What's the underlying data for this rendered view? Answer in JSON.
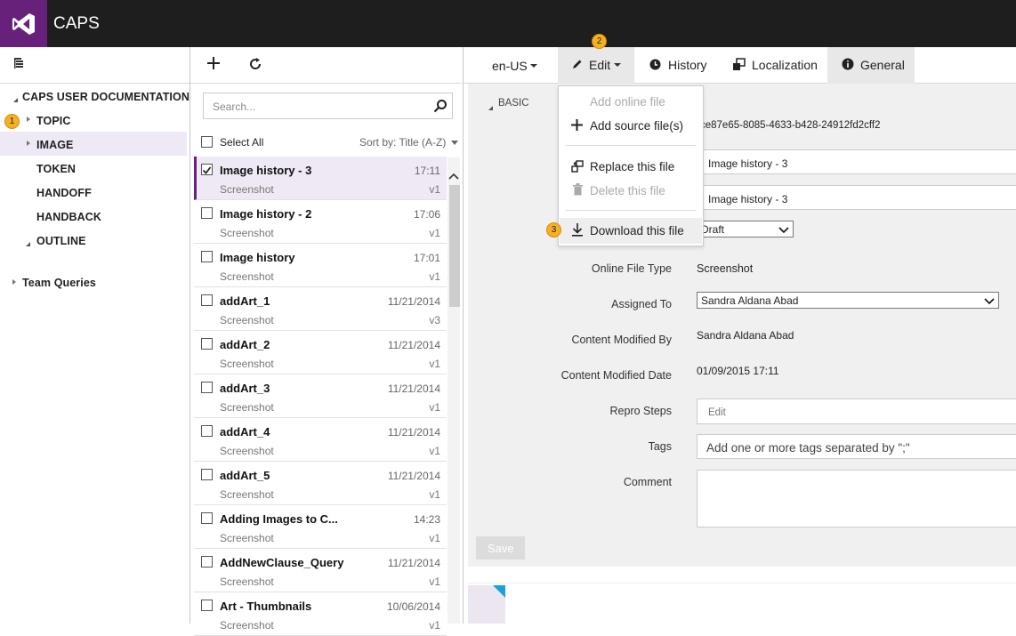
{
  "app": {
    "title": "CAPS"
  },
  "left_tree": {
    "root": "CAPS USER DOCUMENTATION",
    "items": [
      "TOPIC",
      "IMAGE",
      "TOKEN",
      "HANDOFF",
      "HANDBACK",
      "OUTLINE"
    ],
    "team_queries": "Team Queries"
  },
  "badges": {
    "one": "1",
    "two": "2",
    "three": "3"
  },
  "list": {
    "search_placeholder": "Search...",
    "select_all": "Select All",
    "sort_label": "Sort by: Title (A-Z)",
    "rows": [
      {
        "title": "Image history - 3",
        "time": "17:11",
        "sub": "Screenshot",
        "ver": "v1",
        "checked": true
      },
      {
        "title": "Image history - 2",
        "time": "17:06",
        "sub": "Screenshot",
        "ver": "v1"
      },
      {
        "title": "Image history",
        "time": "17:01",
        "sub": "Screenshot",
        "ver": "v1"
      },
      {
        "title": "addArt_1",
        "time": "11/21/2014",
        "sub": "Screenshot",
        "ver": "v3"
      },
      {
        "title": "addArt_2",
        "time": "11/21/2014",
        "sub": "Screenshot",
        "ver": "v1"
      },
      {
        "title": "addArt_3",
        "time": "11/21/2014",
        "sub": "Screenshot",
        "ver": "v1"
      },
      {
        "title": "addArt_4",
        "time": "11/21/2014",
        "sub": "Screenshot",
        "ver": "v1"
      },
      {
        "title": "addArt_5",
        "time": "11/21/2014",
        "sub": "Screenshot",
        "ver": "v1"
      },
      {
        "title": "Adding Images to C...",
        "time": "14:23",
        "sub": "Screenshot",
        "ver": "v1"
      },
      {
        "title": "AddNewClause_Query",
        "time": "11/21/2014",
        "sub": "Screenshot",
        "ver": "v1"
      },
      {
        "title": "Art - Thumbnails",
        "time": "10/06/2014",
        "sub": "Screenshot",
        "ver": "v1"
      }
    ]
  },
  "tabs": {
    "lang": "en-US",
    "edit": "Edit",
    "history": "History",
    "localization": "Localization",
    "general": "General"
  },
  "edit_menu": {
    "add_online": "Add online file",
    "add_source": "Add source file(s)",
    "replace": "Replace this file",
    "delete": "Delete this file",
    "download": "Download this file"
  },
  "form": {
    "section": "BASIC",
    "id_value": "ce87e65-8085-4633-b428-24912fd2cff2",
    "title1": "Image history - 3",
    "title2": "Image history - 3",
    "state": "Draft",
    "online_file_type_label": "Online File Type",
    "online_file_type": "Screenshot",
    "assigned_to_label": "Assigned To",
    "assigned_to": "Sandra Aldana Abad",
    "content_modified_by_label": "Content Modified By",
    "content_modified_by": "Sandra Aldana Abad",
    "content_modified_date_label": "Content Modified Date",
    "content_modified_date": "01/09/2015 17:11",
    "repro_steps_label": "Repro Steps",
    "repro_steps_placeholder": "Edit",
    "tags_label": "Tags",
    "tags_placeholder": "Add one or more tags separated by \";\"",
    "comment_label": "Comment",
    "save": "Save"
  },
  "colors": {
    "accent": "#68217a",
    "selected_bg": "#efe9f5",
    "badge": "#f5b123"
  }
}
